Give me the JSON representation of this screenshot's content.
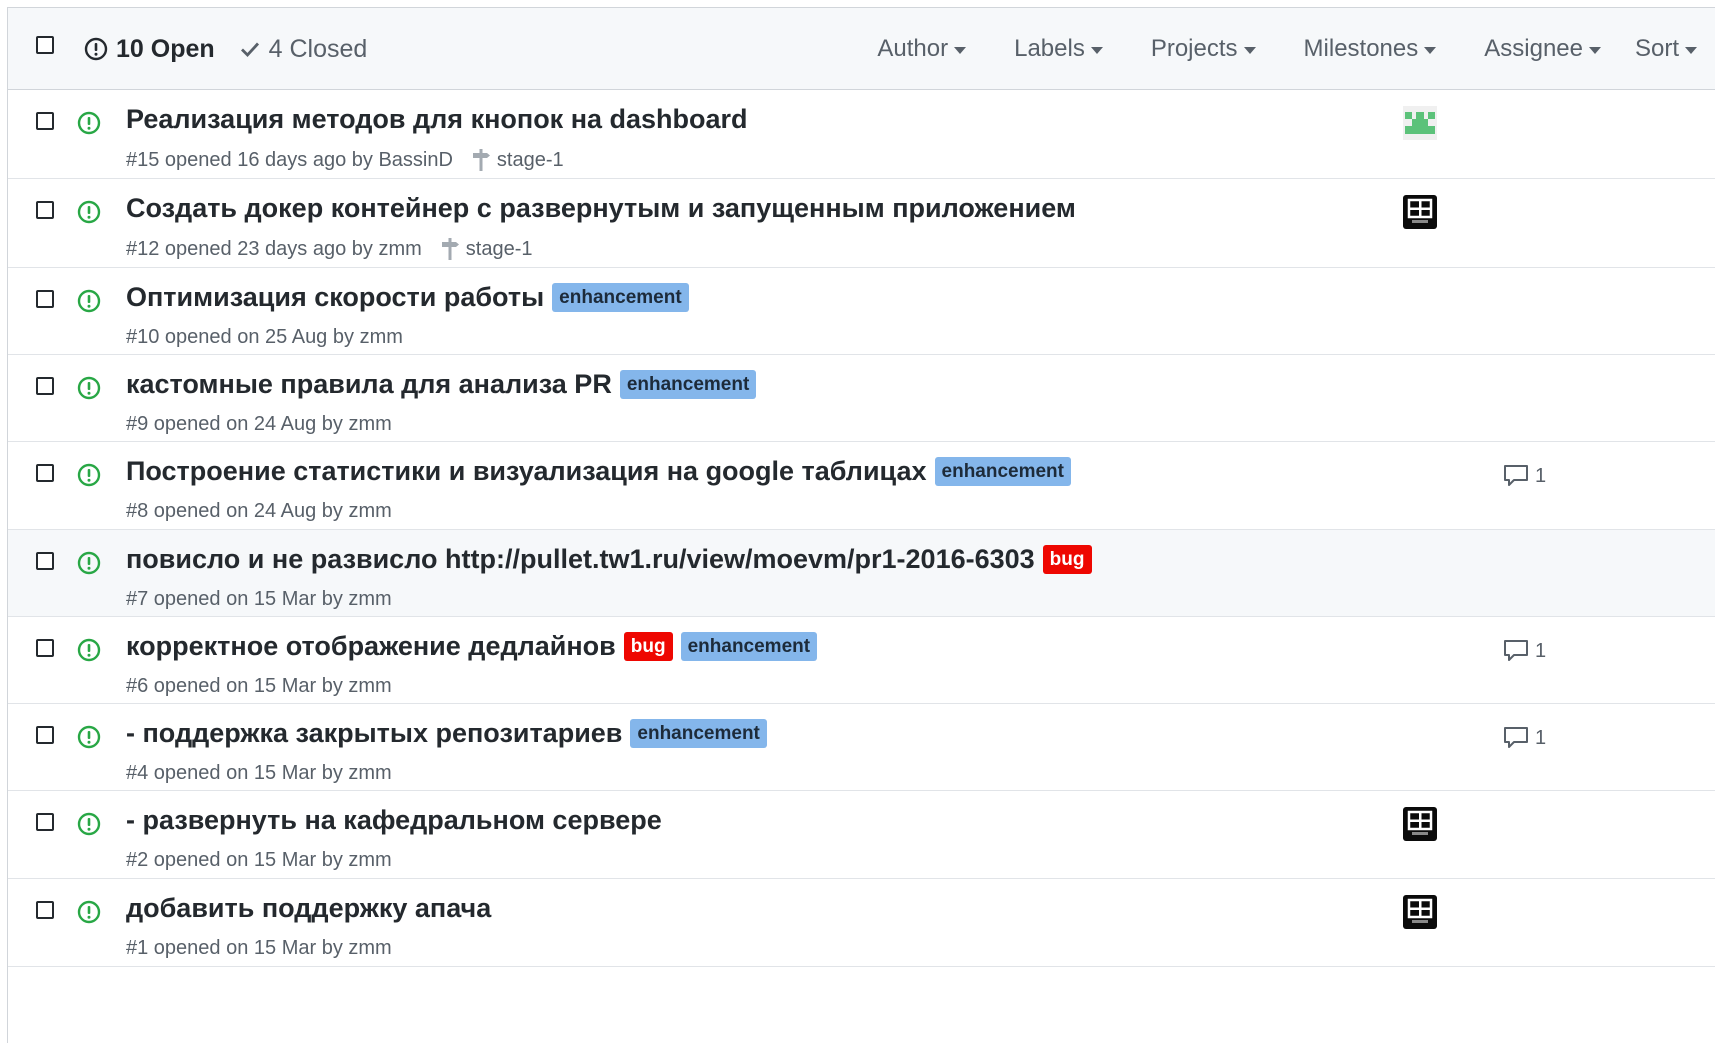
{
  "header": {
    "open_count": "10 Open",
    "closed_count": "4 Closed",
    "filters": [
      "Author",
      "Labels",
      "Projects",
      "Milestones",
      "Assignee",
      "Sort"
    ]
  },
  "colors": {
    "open_icon": "#28a745",
    "enhancement": "#84b6eb",
    "bug": "#ee0701"
  },
  "issues": [
    {
      "title": "Реализация методов для кнопок на dashboard",
      "meta": "#15 opened 16 days ago by",
      "author": "BassinD",
      "milestone": "stage-1",
      "labels": [],
      "avatar": "identicon-green-icon",
      "comments": ""
    },
    {
      "title": "Создать докер контейнер с развернутым и запущенным приложением",
      "meta": "#12 opened 23 days ago by",
      "author": "zmm",
      "milestone": "stage-1",
      "labels": [],
      "avatar": "dark-avatar-icon",
      "comments": ""
    },
    {
      "title": "Оптимизация скорости работы",
      "meta": "#10 opened on 25 Aug by",
      "author": "zmm",
      "milestone": "",
      "labels": [
        "enhancement"
      ],
      "avatar": "",
      "comments": ""
    },
    {
      "title": "кастомные правила для анализа PR",
      "meta": "#9 opened on 24 Aug by",
      "author": "zmm",
      "milestone": "",
      "labels": [
        "enhancement"
      ],
      "avatar": "",
      "comments": ""
    },
    {
      "title": "Построение статистики и визуализация на google таблицах",
      "meta": "#8 opened on 24 Aug by",
      "author": "zmm",
      "milestone": "",
      "labels": [
        "enhancement"
      ],
      "avatar": "",
      "comments": "1"
    },
    {
      "title": "повисло и не развисло http://pullet.tw1.ru/view/moevm/pr1-2016-6303",
      "meta": "#7 opened on 15 Mar by",
      "author": "zmm",
      "milestone": "",
      "labels": [
        "bug"
      ],
      "avatar": "",
      "comments": ""
    },
    {
      "title": "корректное отображение дедлайнов",
      "meta": "#6 opened on 15 Mar by",
      "author": "zmm",
      "milestone": "",
      "labels": [
        "bug",
        "enhancement"
      ],
      "avatar": "",
      "comments": "1"
    },
    {
      "title": "- поддержка закрытых репозитариев",
      "meta": "#4 opened on 15 Mar by",
      "author": "zmm",
      "milestone": "",
      "labels": [
        "enhancement"
      ],
      "avatar": "",
      "comments": "1"
    },
    {
      "title": "- развернуть на кафедральном сервере",
      "meta": "#2 opened on 15 Mar by",
      "author": "zmm",
      "milestone": "",
      "labels": [],
      "avatar": "dark-avatar-icon",
      "comments": ""
    },
    {
      "title": "добавить поддержку апача",
      "meta": "#1 opened on 15 Mar by",
      "author": "zmm",
      "milestone": "",
      "labels": [],
      "avatar": "dark-avatar-icon",
      "comments": ""
    }
  ]
}
